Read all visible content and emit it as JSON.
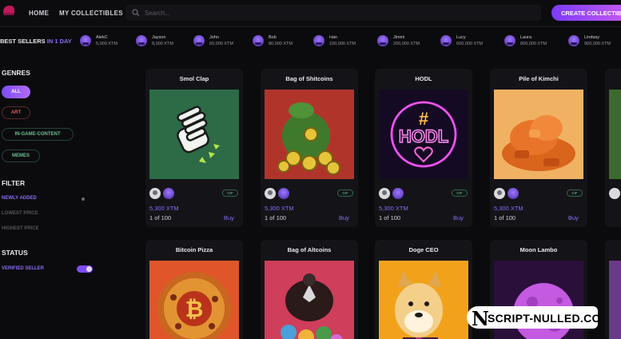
{
  "header": {
    "nav": {
      "home": "HOME",
      "my_collectibles": "MY COLLECTIBLES"
    },
    "search": {
      "placeholder": "Search..."
    },
    "create_label": "CREATE COLLECTIBLE"
  },
  "best_sellers": {
    "title_prefix": "BEST SELLERS",
    "title_suffix": "IN 1 DAY",
    "sellers": [
      {
        "name": "AlekC",
        "amount": "5,000 XTM"
      },
      {
        "name": "Jayson",
        "amount": "8,000 XTM"
      },
      {
        "name": "John",
        "amount": "60,000 XTM"
      },
      {
        "name": "Bob",
        "amount": "80,000 XTM"
      },
      {
        "name": "Han",
        "amount": "100,000 XTM"
      },
      {
        "name": "Jimmi",
        "amount": "200,000 XTM"
      },
      {
        "name": "Lucy",
        "amount": "600,000 XTM"
      },
      {
        "name": "Laura",
        "amount": "800,000 XTM"
      },
      {
        "name": "Lindsay",
        "amount": "900,000 XTM"
      }
    ]
  },
  "sidebar": {
    "genres_title": "GENRES",
    "genres": [
      "ALL",
      "ART",
      "IN-GAME-CONTENT",
      "MEMES"
    ],
    "filter_title": "FILTER",
    "filters": [
      "NEWLY ADDED",
      "LOWEST PRICE",
      "HIGHEST PRICE"
    ],
    "status_title": "STATUS",
    "verified_label": "VERIFIED SELLER"
  },
  "cards": [
    {
      "title": "Smol Clap",
      "badge": "GIF",
      "price": "5,300 XTM",
      "count": "1 of 100",
      "buy": "Buy"
    },
    {
      "title": "Bag of Shitcoins",
      "badge": "GIF",
      "price": "5,300 XTM",
      "count": "1 of 100",
      "buy": "Buy"
    },
    {
      "title": "HODL",
      "badge": "GIF",
      "price": "5,300 XTM",
      "count": "1 of 100",
      "buy": "Buy"
    },
    {
      "title": "Pile of Kimchi",
      "badge": "GIF",
      "price": "5,300 XTM",
      "count": "1 of 100",
      "buy": "Buy"
    },
    {
      "title": "Bitcoin Pizza"
    },
    {
      "title": "Bag of Altcoins"
    },
    {
      "title": "Doge CEO"
    },
    {
      "title": "Moon Lambo"
    }
  ],
  "art_text": {
    "hodl_symbol": "#",
    "hodl_word": "HODL"
  },
  "watermark": {
    "letter": "N",
    "text": "SCRIPT-NULLED.CO"
  }
}
